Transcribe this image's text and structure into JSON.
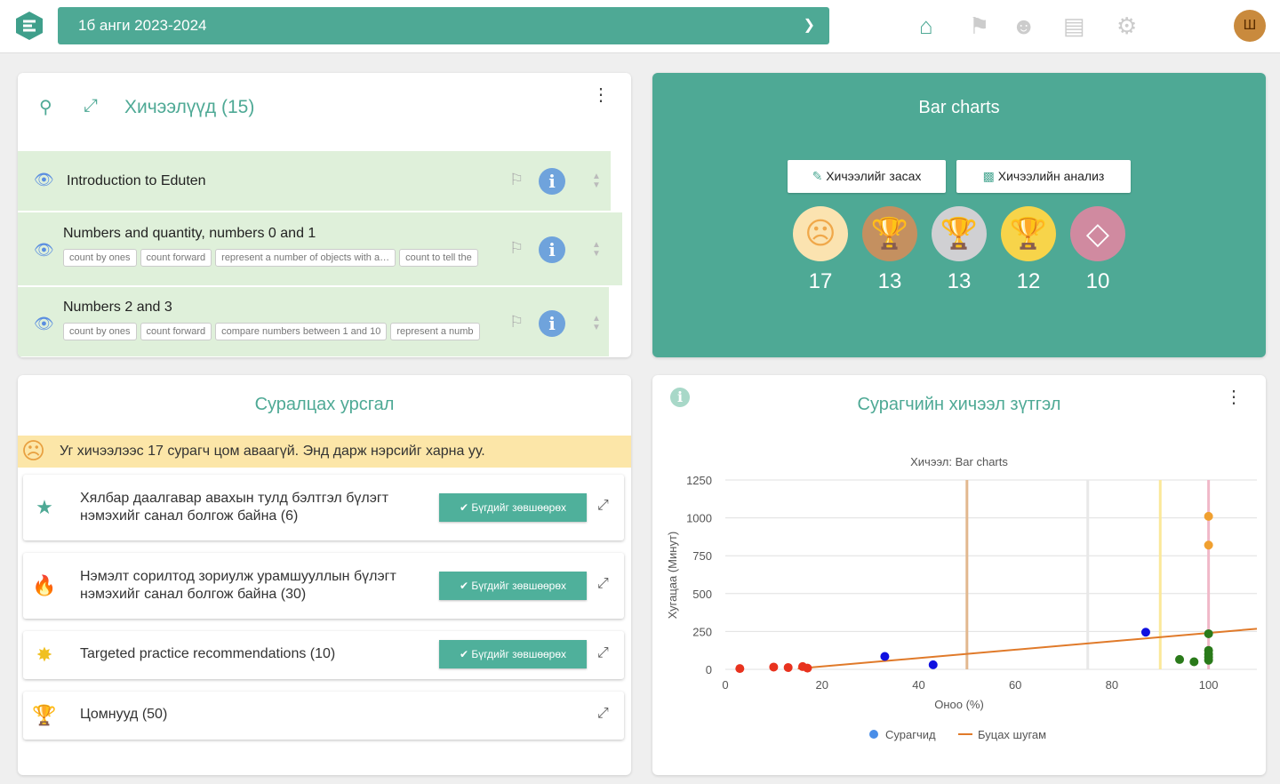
{
  "header": {
    "class_select": "1б анги 2023-2024",
    "avatar_initial": "Ш",
    "nav_icons": [
      "home-icon",
      "bookmark-icon",
      "users-icon",
      "bar-chart-icon",
      "gear-icon"
    ]
  },
  "lessons": {
    "title": "Хичээлүүд (15)",
    "items": [
      {
        "title": "Introduction to Eduten",
        "tags": []
      },
      {
        "title": "Numbers and quantity, numbers 0 and 1",
        "tags": [
          "count by ones",
          "count forward",
          "represent a number of objects with a…",
          "count to tell the"
        ]
      },
      {
        "title": "Numbers 2 and 3",
        "tags": [
          "count by ones",
          "count forward",
          "compare numbers between 1 and 10",
          "represent a numb"
        ]
      }
    ]
  },
  "lesson_panel": {
    "title": "Bar charts",
    "edit_button": "Хичээлийг засах",
    "analysis_button": "Хичээлийн анализ",
    "medals": [
      {
        "icon": "sad-face-icon",
        "count": "17",
        "color": "#fbe3b0"
      },
      {
        "icon": "bronze-trophy-icon",
        "count": "13",
        "color": "#c49060"
      },
      {
        "icon": "silver-trophy-icon",
        "count": "13",
        "color": "#d0d0d3"
      },
      {
        "icon": "gold-trophy-icon",
        "count": "12",
        "color": "#f7d44a"
      },
      {
        "icon": "diamond-icon",
        "count": "10",
        "color": "#d08aa0"
      }
    ]
  },
  "learning_path": {
    "title": "Суралцах урсгал",
    "warning": "Уг хичээлээс 17 сурагч цом аваагүй. Энд дарж нэрсийг харна уу.",
    "recommendations": [
      {
        "icon": "star-icon",
        "text1": "Хялбар даалгавар авахын тулд бэлтгэл бүлэгт",
        "text2": "нэмэхийг санал болгож байна (6)",
        "button": "Бүгдийг зөвшөөрөх"
      },
      {
        "icon": "fire-icon",
        "text1": "Нэмэлт сорилтод зориулж урамшууллын бүлэгт",
        "text2": "нэмэхийг санал болгож байна (30)",
        "button": "Бүгдийг зөвшөөрөх"
      },
      {
        "icon": "badge-icon",
        "text1": "Targeted practice recommendations (10)",
        "text2": "",
        "button": "Бүгдийг зөвшөөрөх"
      },
      {
        "icon": "trophy-icon",
        "text1": "Цомнууд (50)",
        "text2": ""
      }
    ]
  },
  "progress": {
    "title": "Сурагчийн хичээл зүтгэл"
  },
  "chart_data": {
    "type": "scatter",
    "title": "Хичээл: Bar charts",
    "xlabel": "Оноо (%)",
    "ylabel": "Хугацаа (Минут)",
    "xlim": [
      0,
      110
    ],
    "ylim": [
      0,
      1250
    ],
    "xticks": [
      0,
      20,
      40,
      60,
      80,
      100
    ],
    "yticks": [
      0,
      250,
      500,
      750,
      1000,
      1250
    ],
    "grid": true,
    "legend_position": "bottom",
    "legend": [
      "Сурагчид",
      "Буцах шугам"
    ],
    "points": [
      {
        "x": 3,
        "y": 5,
        "color": "#e8321e"
      },
      {
        "x": 10,
        "y": 15,
        "color": "#e8321e"
      },
      {
        "x": 13,
        "y": 12,
        "color": "#e8321e"
      },
      {
        "x": 16,
        "y": 18,
        "color": "#e8321e"
      },
      {
        "x": 17,
        "y": 8,
        "color": "#e8321e"
      },
      {
        "x": 33,
        "y": 85,
        "color": "#1010e0"
      },
      {
        "x": 43,
        "y": 30,
        "color": "#1010e0"
      },
      {
        "x": 87,
        "y": 245,
        "color": "#1010e0"
      },
      {
        "x": 94,
        "y": 65,
        "color": "#2a7a1a"
      },
      {
        "x": 97,
        "y": 50,
        "color": "#2a7a1a"
      },
      {
        "x": 100,
        "y": 235,
        "color": "#2a7a1a"
      },
      {
        "x": 100,
        "y": 125,
        "color": "#2a7a1a"
      },
      {
        "x": 100,
        "y": 100,
        "color": "#2a7a1a"
      },
      {
        "x": 100,
        "y": 80,
        "color": "#2a7a1a"
      },
      {
        "x": 100,
        "y": 60,
        "color": "#2a7a1a"
      },
      {
        "x": 100,
        "y": 1010,
        "color": "#f0a030"
      },
      {
        "x": 100,
        "y": 820,
        "color": "#f0a030"
      }
    ],
    "regression": {
      "from": [
        15,
        5
      ],
      "to": [
        110,
        268
      ],
      "color": "#e07a2a"
    },
    "thresholds": [
      {
        "x": 50,
        "color": "#e2b88f"
      },
      {
        "x": 75,
        "color": "#e8e8e8"
      },
      {
        "x": 90,
        "color": "#fbe89a"
      },
      {
        "x": 100,
        "color": "#f0b8c8"
      }
    ]
  }
}
